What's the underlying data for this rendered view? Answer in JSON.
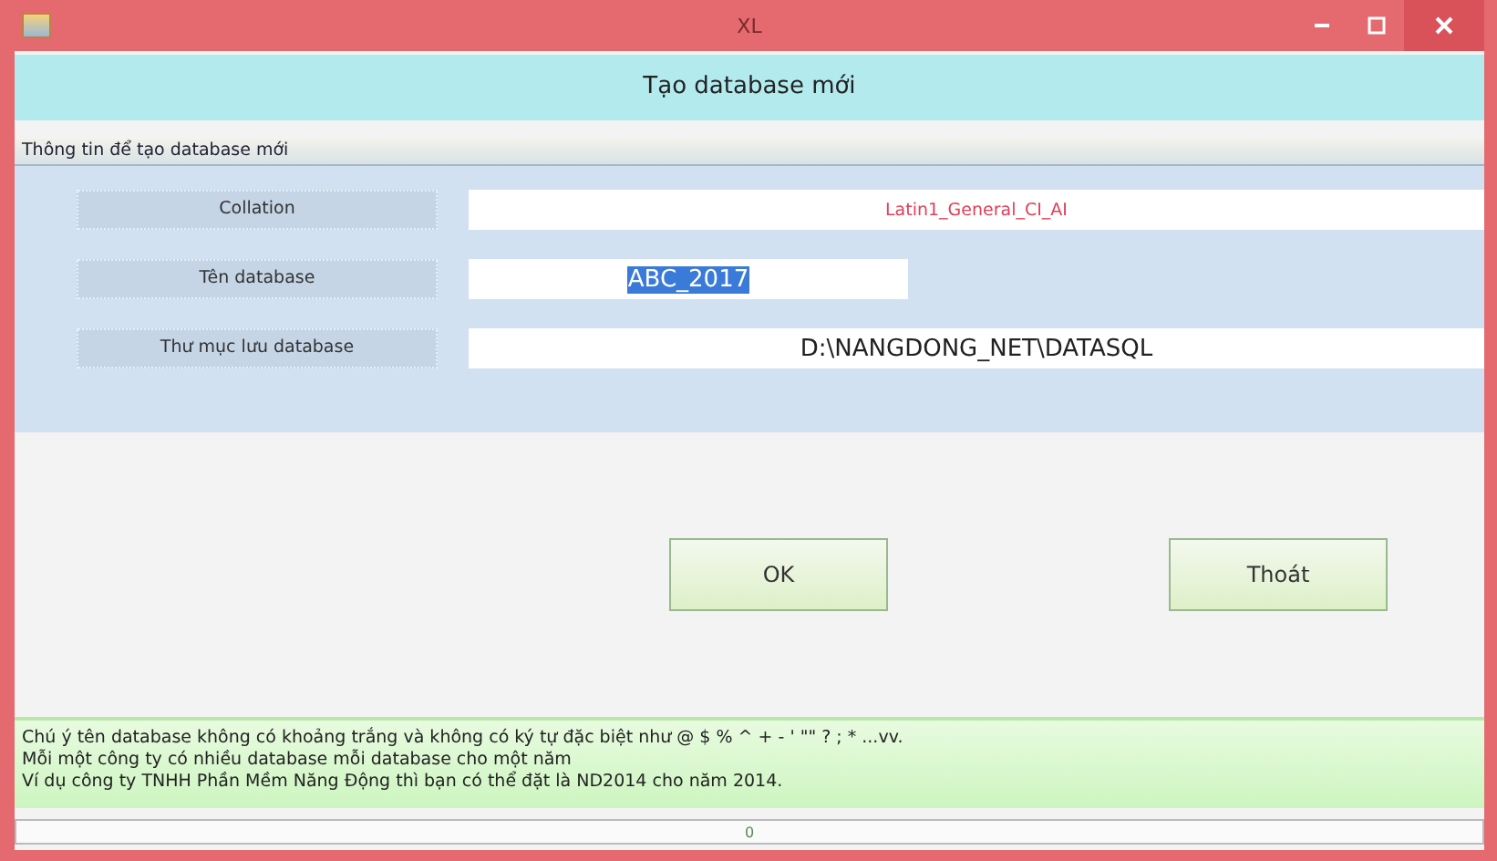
{
  "window": {
    "title": "XL"
  },
  "header": "Tạo database mới",
  "group": {
    "title": "Thông tin để tạo database mới",
    "fields": [
      {
        "label": "Collation",
        "value": "Latin1_General_CI_AI",
        "kind": "red",
        "text_selected": false
      },
      {
        "label": "Tên database",
        "value": "ABC_2017",
        "kind": "short",
        "text_selected": true
      },
      {
        "label": "Thư mục lưu database",
        "value": "D:\\NANGDONG_NET\\DATASQL",
        "kind": "large",
        "text_selected": false
      }
    ]
  },
  "buttons": [
    "OK",
    "Thoát"
  ],
  "notes": [
    "Chú ý tên database không có khoảng trắng và không có ký tự đặc biệt như  @ $ % ^ + - ' \"\" ? ; * ...vv.",
    "Mỗi một công ty có nhiều database mỗi database cho một năm",
    "Ví dụ công ty TNHH Phần Mềm Năng Động thì bạn có thể đặt là ND2014 cho năm 2014."
  ],
  "progress": {
    "level": 0,
    "reading": "0"
  }
}
